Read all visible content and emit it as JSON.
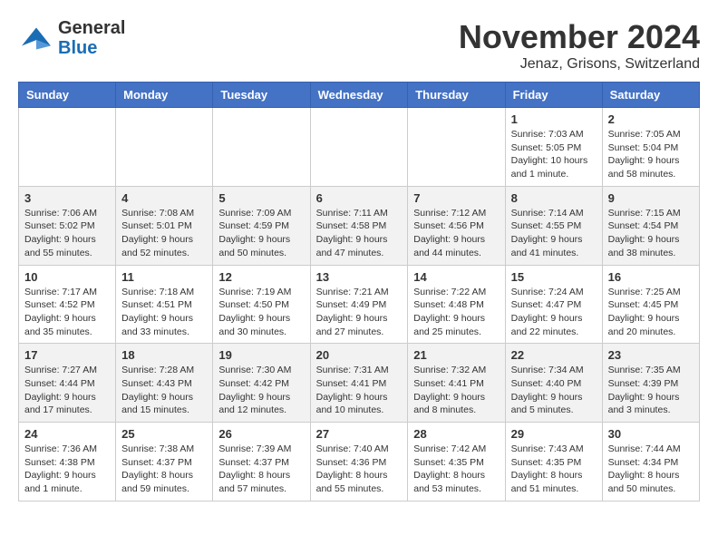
{
  "header": {
    "logo_general": "General",
    "logo_blue": "Blue",
    "month_title": "November 2024",
    "location": "Jenaz, Grisons, Switzerland"
  },
  "calendar": {
    "days_of_week": [
      "Sunday",
      "Monday",
      "Tuesday",
      "Wednesday",
      "Thursday",
      "Friday",
      "Saturday"
    ],
    "weeks": [
      [
        {
          "day": "",
          "info": ""
        },
        {
          "day": "",
          "info": ""
        },
        {
          "day": "",
          "info": ""
        },
        {
          "day": "",
          "info": ""
        },
        {
          "day": "",
          "info": ""
        },
        {
          "day": "1",
          "info": "Sunrise: 7:03 AM\nSunset: 5:05 PM\nDaylight: 10 hours and 1 minute."
        },
        {
          "day": "2",
          "info": "Sunrise: 7:05 AM\nSunset: 5:04 PM\nDaylight: 9 hours and 58 minutes."
        }
      ],
      [
        {
          "day": "3",
          "info": "Sunrise: 7:06 AM\nSunset: 5:02 PM\nDaylight: 9 hours and 55 minutes."
        },
        {
          "day": "4",
          "info": "Sunrise: 7:08 AM\nSunset: 5:01 PM\nDaylight: 9 hours and 52 minutes."
        },
        {
          "day": "5",
          "info": "Sunrise: 7:09 AM\nSunset: 4:59 PM\nDaylight: 9 hours and 50 minutes."
        },
        {
          "day": "6",
          "info": "Sunrise: 7:11 AM\nSunset: 4:58 PM\nDaylight: 9 hours and 47 minutes."
        },
        {
          "day": "7",
          "info": "Sunrise: 7:12 AM\nSunset: 4:56 PM\nDaylight: 9 hours and 44 minutes."
        },
        {
          "day": "8",
          "info": "Sunrise: 7:14 AM\nSunset: 4:55 PM\nDaylight: 9 hours and 41 minutes."
        },
        {
          "day": "9",
          "info": "Sunrise: 7:15 AM\nSunset: 4:54 PM\nDaylight: 9 hours and 38 minutes."
        }
      ],
      [
        {
          "day": "10",
          "info": "Sunrise: 7:17 AM\nSunset: 4:52 PM\nDaylight: 9 hours and 35 minutes."
        },
        {
          "day": "11",
          "info": "Sunrise: 7:18 AM\nSunset: 4:51 PM\nDaylight: 9 hours and 33 minutes."
        },
        {
          "day": "12",
          "info": "Sunrise: 7:19 AM\nSunset: 4:50 PM\nDaylight: 9 hours and 30 minutes."
        },
        {
          "day": "13",
          "info": "Sunrise: 7:21 AM\nSunset: 4:49 PM\nDaylight: 9 hours and 27 minutes."
        },
        {
          "day": "14",
          "info": "Sunrise: 7:22 AM\nSunset: 4:48 PM\nDaylight: 9 hours and 25 minutes."
        },
        {
          "day": "15",
          "info": "Sunrise: 7:24 AM\nSunset: 4:47 PM\nDaylight: 9 hours and 22 minutes."
        },
        {
          "day": "16",
          "info": "Sunrise: 7:25 AM\nSunset: 4:45 PM\nDaylight: 9 hours and 20 minutes."
        }
      ],
      [
        {
          "day": "17",
          "info": "Sunrise: 7:27 AM\nSunset: 4:44 PM\nDaylight: 9 hours and 17 minutes."
        },
        {
          "day": "18",
          "info": "Sunrise: 7:28 AM\nSunset: 4:43 PM\nDaylight: 9 hours and 15 minutes."
        },
        {
          "day": "19",
          "info": "Sunrise: 7:30 AM\nSunset: 4:42 PM\nDaylight: 9 hours and 12 minutes."
        },
        {
          "day": "20",
          "info": "Sunrise: 7:31 AM\nSunset: 4:41 PM\nDaylight: 9 hours and 10 minutes."
        },
        {
          "day": "21",
          "info": "Sunrise: 7:32 AM\nSunset: 4:41 PM\nDaylight: 9 hours and 8 minutes."
        },
        {
          "day": "22",
          "info": "Sunrise: 7:34 AM\nSunset: 4:40 PM\nDaylight: 9 hours and 5 minutes."
        },
        {
          "day": "23",
          "info": "Sunrise: 7:35 AM\nSunset: 4:39 PM\nDaylight: 9 hours and 3 minutes."
        }
      ],
      [
        {
          "day": "24",
          "info": "Sunrise: 7:36 AM\nSunset: 4:38 PM\nDaylight: 9 hours and 1 minute."
        },
        {
          "day": "25",
          "info": "Sunrise: 7:38 AM\nSunset: 4:37 PM\nDaylight: 8 hours and 59 minutes."
        },
        {
          "day": "26",
          "info": "Sunrise: 7:39 AM\nSunset: 4:37 PM\nDaylight: 8 hours and 57 minutes."
        },
        {
          "day": "27",
          "info": "Sunrise: 7:40 AM\nSunset: 4:36 PM\nDaylight: 8 hours and 55 minutes."
        },
        {
          "day": "28",
          "info": "Sunrise: 7:42 AM\nSunset: 4:35 PM\nDaylight: 8 hours and 53 minutes."
        },
        {
          "day": "29",
          "info": "Sunrise: 7:43 AM\nSunset: 4:35 PM\nDaylight: 8 hours and 51 minutes."
        },
        {
          "day": "30",
          "info": "Sunrise: 7:44 AM\nSunset: 4:34 PM\nDaylight: 8 hours and 50 minutes."
        }
      ]
    ]
  }
}
